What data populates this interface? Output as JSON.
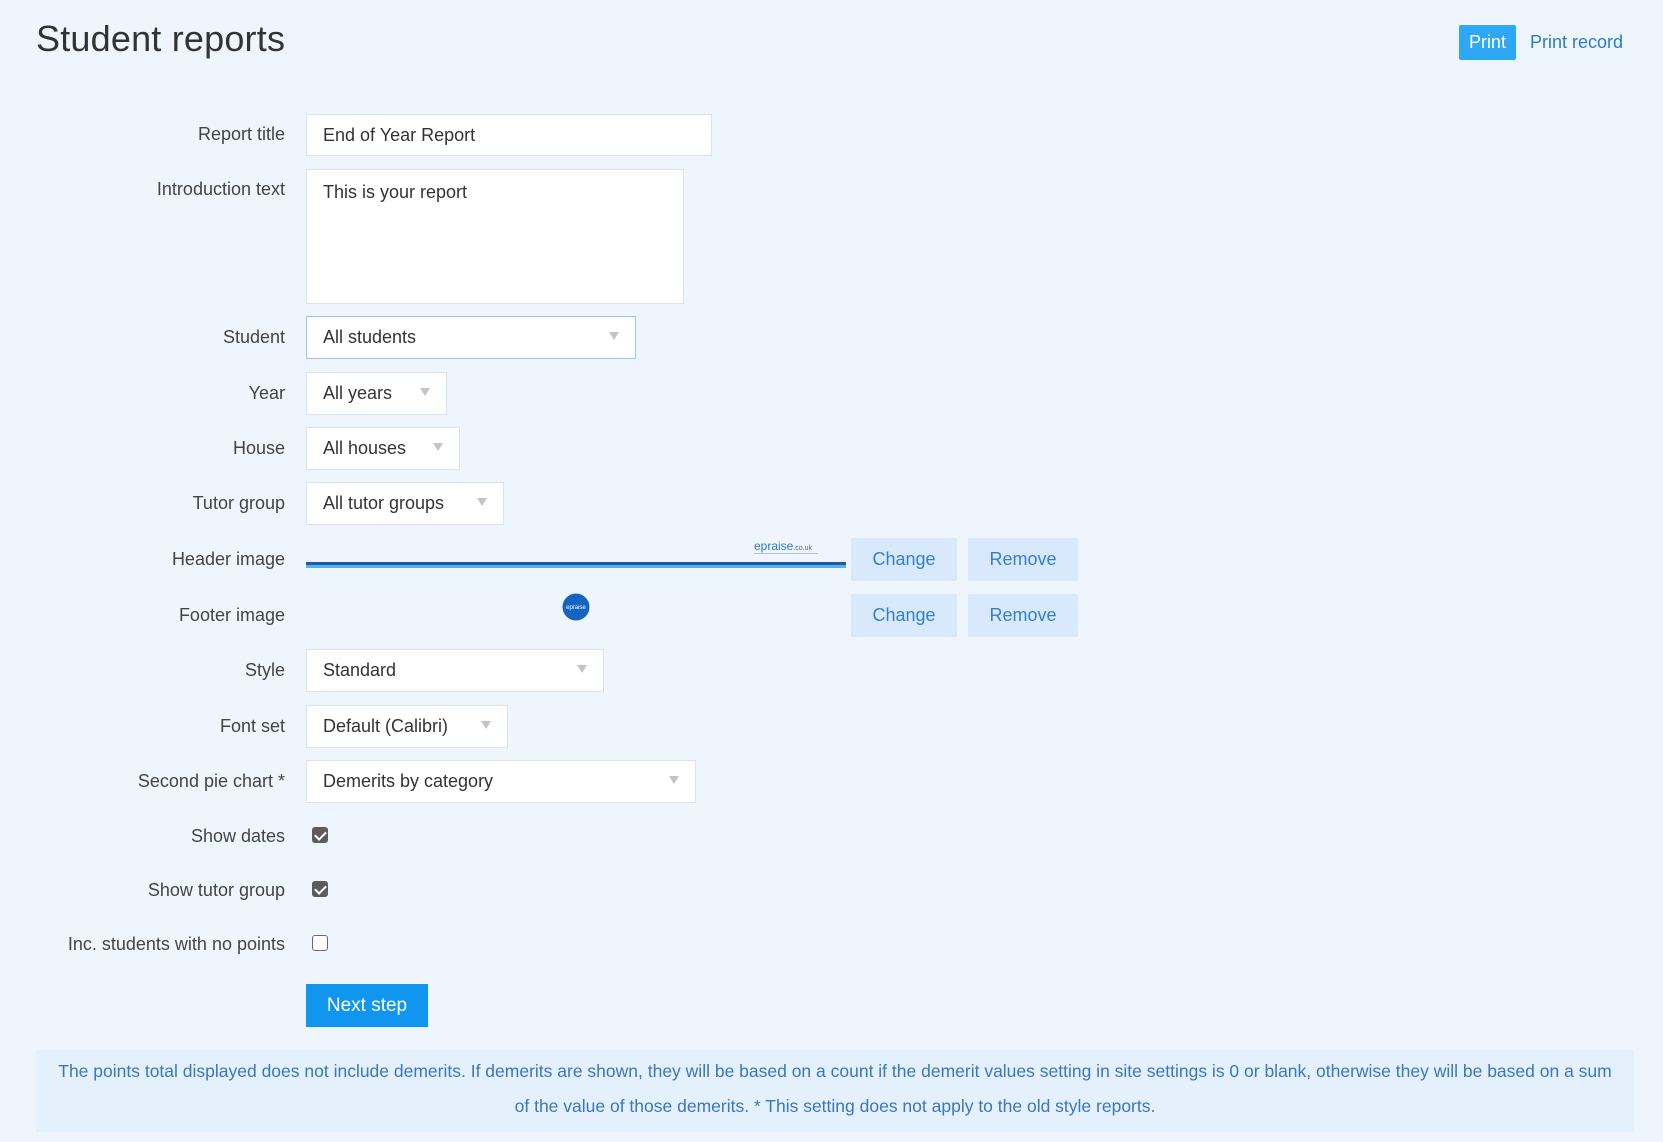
{
  "header": {
    "title": "Student reports",
    "print_label": "Print",
    "print_record_label": "Print record"
  },
  "form": {
    "report_title": {
      "label": "Report title",
      "value": "End of Year Report"
    },
    "intro_text": {
      "label": "Introduction text",
      "value": "This is your report"
    },
    "student": {
      "label": "Student",
      "value": "All students"
    },
    "year": {
      "label": "Year",
      "value": "All years"
    },
    "house": {
      "label": "House",
      "value": "All houses"
    },
    "tutor_group": {
      "label": "Tutor group",
      "value": "All tutor groups"
    },
    "header_image": {
      "label": "Header image",
      "logo_text": "epraise",
      "logo_suffix": ".co.uk",
      "change_label": "Change",
      "remove_label": "Remove"
    },
    "footer_image": {
      "label": "Footer image",
      "logo_text": "epraise",
      "change_label": "Change",
      "remove_label": "Remove"
    },
    "style": {
      "label": "Style",
      "value": "Standard"
    },
    "font_set": {
      "label": "Font set",
      "value": "Default (Calibri)"
    },
    "second_pie_chart": {
      "label": "Second pie chart *",
      "value": "Demerits by category"
    },
    "show_dates": {
      "label": "Show dates",
      "checked": true
    },
    "show_tutor_group": {
      "label": "Show tutor group",
      "checked": true
    },
    "inc_no_points": {
      "label": "Inc. students with no points",
      "checked": false
    },
    "next_step_label": "Next step"
  },
  "info": {
    "text": "The points total displayed does not include demerits. If demerits are shown, they will be based on a count if the demerit values setting in site settings is 0 or blank, otherwise they will be based on a sum of the value of those demerits. * This setting does not apply to the old style reports."
  },
  "colors": {
    "background": "#eef5fd",
    "primary": "#1196ef",
    "print_button": "#2ea8f5",
    "light_button": "#d7e9fb",
    "link": "#2b7cc4",
    "info_text": "#3a78b8"
  }
}
